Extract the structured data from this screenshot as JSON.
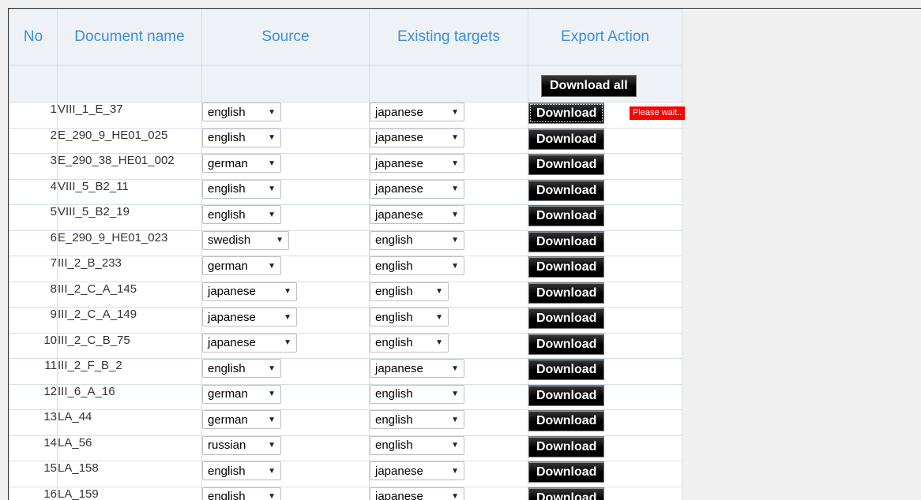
{
  "headers": {
    "no": "No",
    "document_name": "Document name",
    "source": "Source",
    "existing_targets": "Existing targets",
    "export_action": "Export Action"
  },
  "download_all_label": "Download all",
  "download_label": "Download",
  "please_wait": "Please wait..",
  "rows": [
    {
      "no": "1",
      "name": "VIII_1_E_37",
      "source": "english",
      "target": "japanese"
    },
    {
      "no": "2",
      "name": "E_290_9_HE01_025",
      "source": "english",
      "target": "japanese"
    },
    {
      "no": "3",
      "name": "E_290_38_HE01_002",
      "source": "german",
      "target": "japanese"
    },
    {
      "no": "4",
      "name": "VIII_5_B2_11",
      "source": "english",
      "target": "japanese"
    },
    {
      "no": "5",
      "name": "VIII_5_B2_19",
      "source": "english",
      "target": "japanese"
    },
    {
      "no": "6",
      "name": "E_290_9_HE01_023",
      "source": "swedish",
      "target": "english"
    },
    {
      "no": "7",
      "name": "III_2_B_233",
      "source": "german",
      "target": "english"
    },
    {
      "no": "8",
      "name": "III_2_C_A_145",
      "source": "japanese",
      "target": "english"
    },
    {
      "no": "9",
      "name": "III_2_C_A_149",
      "source": "japanese",
      "target": "english"
    },
    {
      "no": "10",
      "name": "III_2_C_B_75",
      "source": "japanese",
      "target": "english"
    },
    {
      "no": "11",
      "name": "III_2_F_B_2",
      "source": "english",
      "target": "japanese"
    },
    {
      "no": "12",
      "name": "III_6_A_16",
      "source": "german",
      "target": "english"
    },
    {
      "no": "13",
      "name": "LA_44",
      "source": "german",
      "target": "english"
    },
    {
      "no": "14",
      "name": "LA_56",
      "source": "russian",
      "target": "english"
    },
    {
      "no": "15",
      "name": "LA_158",
      "source": "english",
      "target": "japanese"
    },
    {
      "no": "16",
      "name": "LA_159",
      "source": "english",
      "target": "japanese"
    }
  ]
}
